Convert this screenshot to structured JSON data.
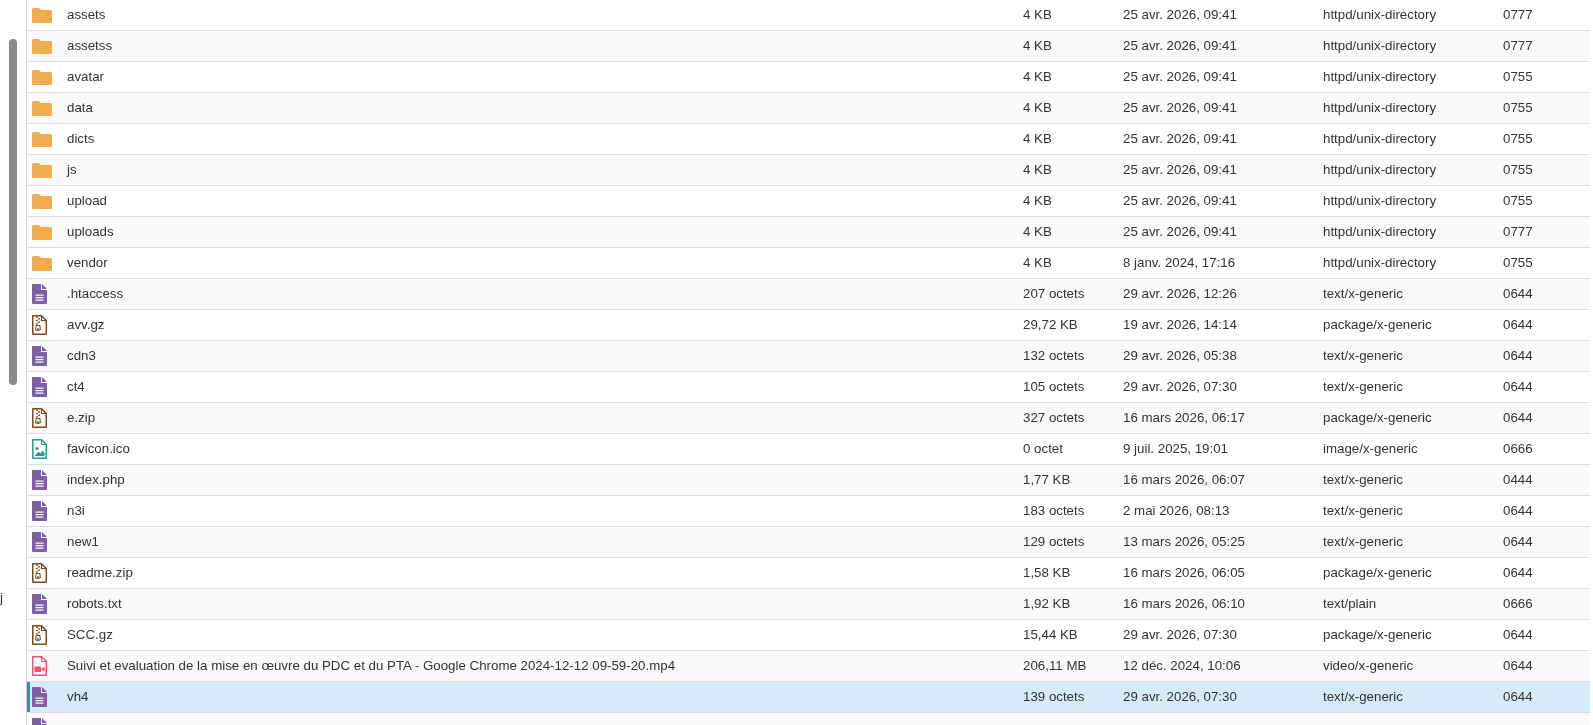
{
  "left_edge": {
    "text": "j"
  },
  "file_list": {
    "rows": [
      {
        "kind": "folder",
        "name": "assets",
        "size": "4 KB",
        "modified": "25 avr. 2026, 09:41",
        "type": "httpd/unix-directory",
        "permissions": "0777",
        "selected": false
      },
      {
        "kind": "folder",
        "name": "assetss",
        "size": "4 KB",
        "modified": "25 avr. 2026, 09:41",
        "type": "httpd/unix-directory",
        "permissions": "0777",
        "selected": false
      },
      {
        "kind": "folder",
        "name": "avatar",
        "size": "4 KB",
        "modified": "25 avr. 2026, 09:41",
        "type": "httpd/unix-directory",
        "permissions": "0755",
        "selected": false
      },
      {
        "kind": "folder",
        "name": "data",
        "size": "4 KB",
        "modified": "25 avr. 2026, 09:41",
        "type": "httpd/unix-directory",
        "permissions": "0755",
        "selected": false
      },
      {
        "kind": "folder",
        "name": "dicts",
        "size": "4 KB",
        "modified": "25 avr. 2026, 09:41",
        "type": "httpd/unix-directory",
        "permissions": "0755",
        "selected": false
      },
      {
        "kind": "folder",
        "name": "js",
        "size": "4 KB",
        "modified": "25 avr. 2026, 09:41",
        "type": "httpd/unix-directory",
        "permissions": "0755",
        "selected": false
      },
      {
        "kind": "folder",
        "name": "upload",
        "size": "4 KB",
        "modified": "25 avr. 2026, 09:41",
        "type": "httpd/unix-directory",
        "permissions": "0755",
        "selected": false
      },
      {
        "kind": "folder",
        "name": "uploads",
        "size": "4 KB",
        "modified": "25 avr. 2026, 09:41",
        "type": "httpd/unix-directory",
        "permissions": "0777",
        "selected": false
      },
      {
        "kind": "folder",
        "name": "vendor",
        "size": "4 KB",
        "modified": "8 janv. 2024, 17:16",
        "type": "httpd/unix-directory",
        "permissions": "0755",
        "selected": false
      },
      {
        "kind": "text",
        "name": ".htaccess",
        "size": "207 octets",
        "modified": "29 avr. 2026, 12:26",
        "type": "text/x-generic",
        "permissions": "0644",
        "selected": false
      },
      {
        "kind": "archive",
        "name": "avv.gz",
        "size": "29,72 KB",
        "modified": "19 avr. 2026, 14:14",
        "type": "package/x-generic",
        "permissions": "0644",
        "selected": false
      },
      {
        "kind": "text",
        "name": "cdn3",
        "size": "132 octets",
        "modified": "29 avr. 2026, 05:38",
        "type": "text/x-generic",
        "permissions": "0644",
        "selected": false
      },
      {
        "kind": "text",
        "name": "ct4",
        "size": "105 octets",
        "modified": "29 avr. 2026, 07:30",
        "type": "text/x-generic",
        "permissions": "0644",
        "selected": false
      },
      {
        "kind": "archive",
        "name": "e.zip",
        "size": "327 octets",
        "modified": "16 mars 2026, 06:17",
        "type": "package/x-generic",
        "permissions": "0644",
        "selected": false
      },
      {
        "kind": "image",
        "name": "favicon.ico",
        "size": "0 octet",
        "modified": "9 juil. 2025, 19:01",
        "type": "image/x-generic",
        "permissions": "0666",
        "selected": false
      },
      {
        "kind": "text",
        "name": "index.php",
        "size": "1,77 KB",
        "modified": "16 mars 2026, 06:07",
        "type": "text/x-generic",
        "permissions": "0444",
        "selected": false
      },
      {
        "kind": "text",
        "name": "n3i",
        "size": "183 octets",
        "modified": "2 mai 2026, 08:13",
        "type": "text/x-generic",
        "permissions": "0644",
        "selected": false
      },
      {
        "kind": "text",
        "name": "new1",
        "size": "129 octets",
        "modified": "13 mars 2026, 05:25",
        "type": "text/x-generic",
        "permissions": "0644",
        "selected": false
      },
      {
        "kind": "archive",
        "name": "readme.zip",
        "size": "1,58 KB",
        "modified": "16 mars 2026, 06:05",
        "type": "package/x-generic",
        "permissions": "0644",
        "selected": false
      },
      {
        "kind": "text",
        "name": "robots.txt",
        "size": "1,92 KB",
        "modified": "16 mars 2026, 06:10",
        "type": "text/plain",
        "permissions": "0666",
        "selected": false
      },
      {
        "kind": "archive",
        "name": "SCC.gz",
        "size": "15,44 KB",
        "modified": "29 avr. 2026, 07:30",
        "type": "package/x-generic",
        "permissions": "0644",
        "selected": false
      },
      {
        "kind": "video",
        "name": "Suivi et evaluation de la mise en œuvre du PDC et du PTA - Google Chrome 2024-12-12 09-59-20.mp4",
        "size": "206,11 MB",
        "modified": "12 déc. 2024, 10:06",
        "type": "video/x-generic",
        "permissions": "0644",
        "selected": false
      },
      {
        "kind": "text",
        "name": "vh4",
        "size": "139 octets",
        "modified": "29 avr. 2026, 07:30",
        "type": "text/x-generic",
        "permissions": "0644",
        "selected": true
      },
      {
        "kind": "text",
        "selected": false
      }
    ]
  }
}
